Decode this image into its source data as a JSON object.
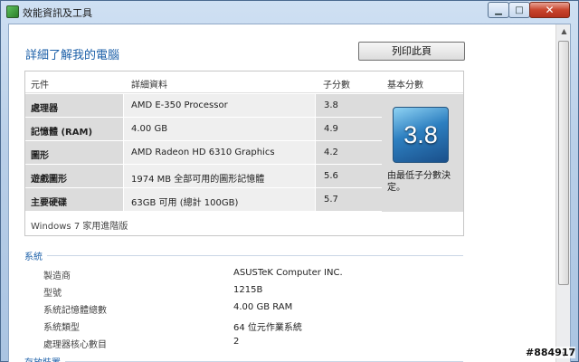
{
  "window": {
    "title": "效能資訊及工具"
  },
  "page": {
    "title": "詳細了解我的電腦",
    "print_button": "列印此頁"
  },
  "table": {
    "headers": [
      "元件",
      "詳細資料",
      "子分數",
      "基本分數"
    ],
    "rows": [
      {
        "component": "處理器",
        "detail": "AMD E-350 Processor",
        "subscore": "3.8"
      },
      {
        "component": "記憶體 (RAM)",
        "detail": "4.00 GB",
        "subscore": "4.9"
      },
      {
        "component": "圖形",
        "detail": "AMD Radeon HD 6310 Graphics",
        "subscore": "4.2"
      },
      {
        "component": "遊戲圖形",
        "detail": "1974 MB 全部可用的圖形記憶體",
        "subscore": "5.6"
      },
      {
        "component": "主要硬碟",
        "detail": "63GB 可用 (總計 100GB)",
        "subscore": "5.7"
      }
    ],
    "base_score": "3.8",
    "base_note": "由最低子分數決定。",
    "edition": "Windows 7 家用進階版"
  },
  "system": {
    "heading": "系統",
    "items": [
      {
        "label": "製造商",
        "value": "ASUSTeK Computer INC."
      },
      {
        "label": "型號",
        "value": "1215B"
      },
      {
        "label": "系統記憶體總數",
        "value": "4.00 GB RAM"
      },
      {
        "label": "系統類型",
        "value": "64 位元作業系統"
      },
      {
        "label": "處理器核心數目",
        "value": "2"
      }
    ]
  },
  "storage": {
    "heading": "存放裝置"
  },
  "watermark": "#884917",
  "colors": {
    "accent": "#1b5fa8",
    "close_button": "#c8442c",
    "score_badge": "#2d7fc0"
  },
  "icons": {
    "app": "performance-icon",
    "minimize": "minimize-icon",
    "maximize": "maximize-icon",
    "close": "close-icon"
  }
}
